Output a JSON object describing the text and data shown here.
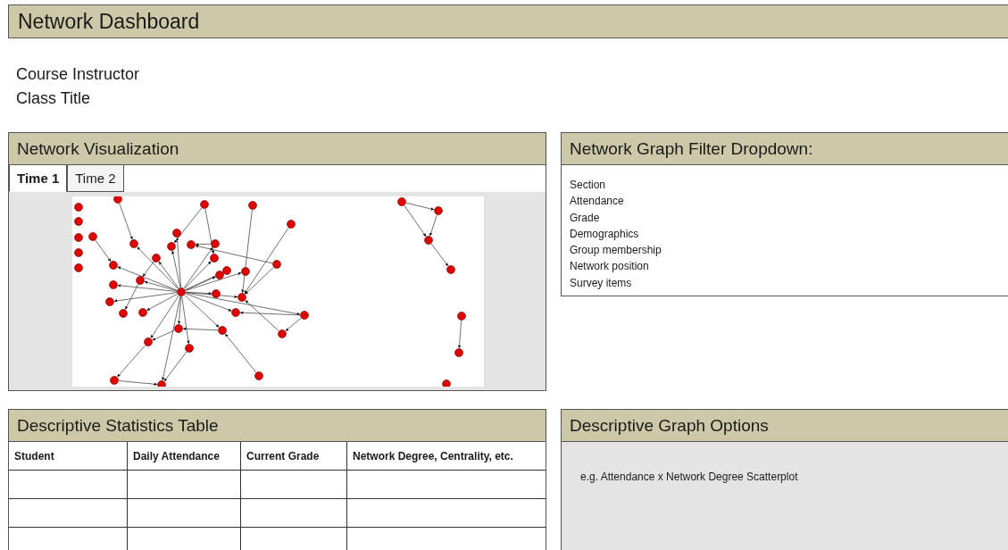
{
  "title": "Network Dashboard",
  "course_lines": [
    "Course Instructor",
    "Class Title"
  ],
  "network_visualization": {
    "title": "Network Visualization",
    "tabs": [
      {
        "label": "Time 1",
        "selected": true
      },
      {
        "label": "Time 2",
        "selected": false
      }
    ]
  },
  "filter_panel": {
    "title": "Network Graph Filter Dropdown:",
    "options": [
      "Section",
      "Attendance",
      "Grade",
      "Demographics",
      "Group membership",
      "Network position",
      "Survey items"
    ]
  },
  "statistics_table": {
    "title": "Descriptive Statistics Table",
    "columns": [
      "Student",
      "Daily Attendance",
      "Current Grade",
      "Network Degree, Centrality, etc."
    ]
  },
  "graph_options": {
    "title": "Descriptive Graph Options",
    "note": "e.g. Attendance x Network Degree Scatterplot"
  }
}
